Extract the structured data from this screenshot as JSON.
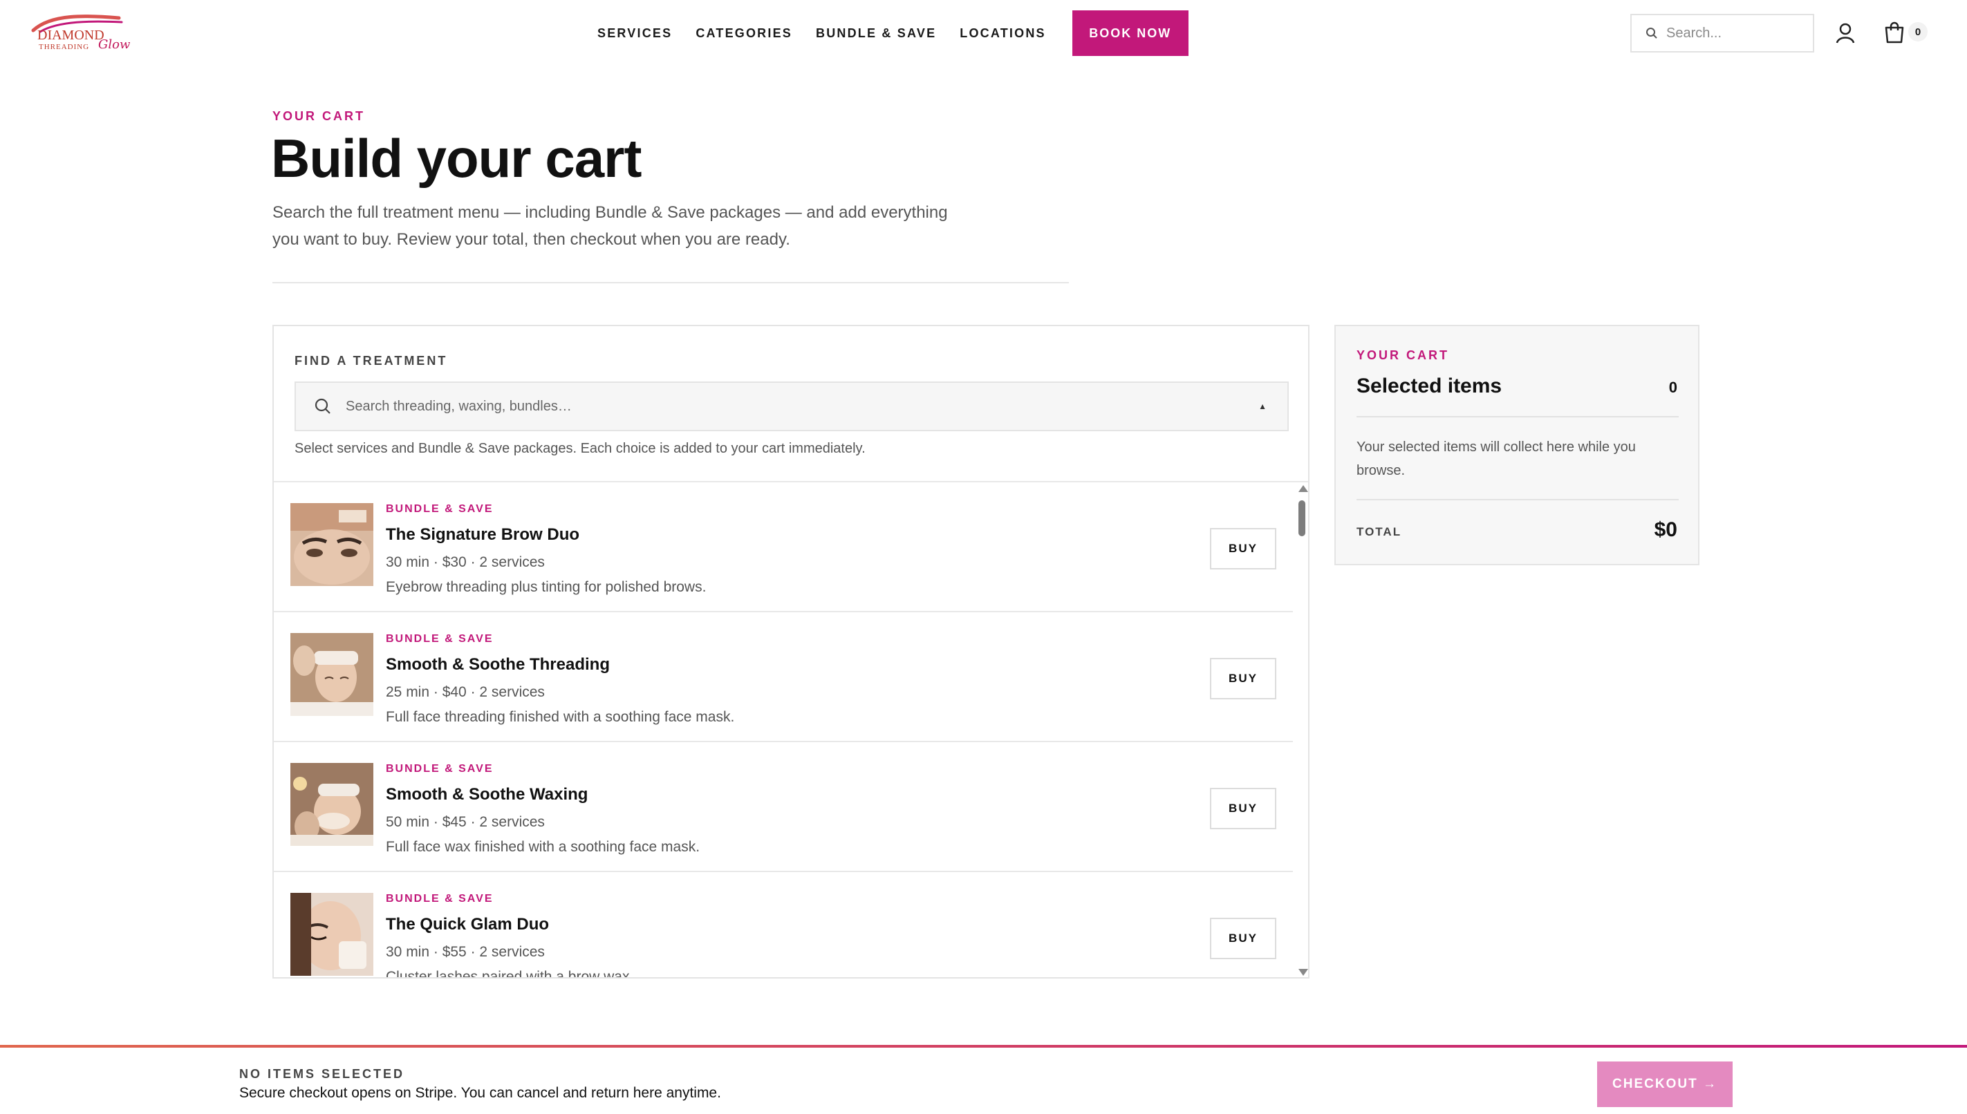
{
  "brand": {
    "logo_line1": "DIAMOND",
    "logo_line2": "THREADING",
    "logo_line3": "Glow",
    "accent_color": "#c2187a"
  },
  "nav": {
    "items": [
      "SERVICES",
      "CATEGORIES",
      "BUNDLE & SAVE",
      "LOCATIONS"
    ],
    "book_label": "BOOK NOW"
  },
  "header": {
    "search_placeholder": "Search...",
    "cart_count": "0",
    "icons": [
      "search-icon",
      "user-icon",
      "cart-icon"
    ]
  },
  "hero": {
    "eyebrow": "YOUR CART",
    "title": "Build your cart",
    "intro": "Search the full treatment menu — including Bundle & Save packages — and add everything you want to buy. Review your total, then checkout when you are ready."
  },
  "finder": {
    "label": "FIND A TREATMENT",
    "search_placeholder": "Search threading, waxing, bundles…",
    "helper": "Select services and Bundle & Save packages. Each choice is added to your cart immediately."
  },
  "treatments": [
    {
      "tag": "BUNDLE & SAVE",
      "name": "The Signature Brow Duo",
      "meta": "30 min · $30 · 2 services",
      "desc": "Eyebrow threading plus tinting for polished brows.",
      "buy": "BUY"
    },
    {
      "tag": "BUNDLE & SAVE",
      "name": "Smooth & Soothe Threading",
      "meta": "25 min · $40 · 2 services",
      "desc": "Full face threading finished with a soothing face mask.",
      "buy": "BUY"
    },
    {
      "tag": "BUNDLE & SAVE",
      "name": "Smooth & Soothe Waxing",
      "meta": "50 min · $45 · 2 services",
      "desc": "Full face wax finished with a soothing face mask.",
      "buy": "BUY"
    },
    {
      "tag": "BUNDLE & SAVE",
      "name": "The Quick Glam Duo",
      "meta": "30 min · $55 · 2 services",
      "desc": "Cluster lashes paired with a brow wax.",
      "buy": "BUY"
    }
  ],
  "cart": {
    "eyebrow": "YOUR CART",
    "title": "Selected items",
    "count": "0",
    "message": "Your selected items will collect here while you browse.",
    "total_label": "TOTAL",
    "total_value": "$0"
  },
  "footer": {
    "status": "NO ITEMS SELECTED",
    "note": "Secure checkout opens on Stripe. You can cancel and return here anytime.",
    "checkout_label": "CHECKOUT →"
  }
}
